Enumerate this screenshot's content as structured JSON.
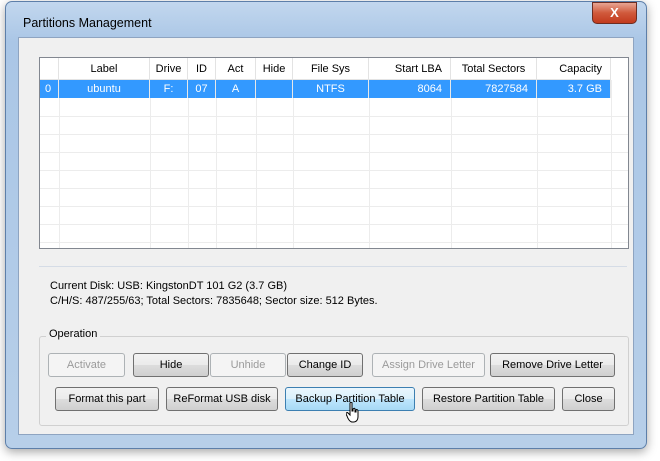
{
  "window": {
    "title": "Partitions Management",
    "close_glyph": "X"
  },
  "table": {
    "columns": [
      "",
      "Label",
      "Drive",
      "ID",
      "Act",
      "Hide",
      "File Sys",
      "Start LBA",
      "Total Sectors",
      "Capacity"
    ],
    "rows": [
      {
        "index": "0",
        "label": "ubuntu",
        "drive": "F:",
        "id": "07",
        "act": "A",
        "hide": "",
        "fs": "NTFS",
        "start_lba": "8064",
        "total_sectors": "7827584",
        "capacity": "3.7 GB"
      }
    ]
  },
  "disk_info": {
    "line1": "Current Disk:   USB: KingstonDT 101 G2 (3.7 GB)",
    "line2": "C/H/S: 487/255/63; Total Sectors: 7835648; Sector size: 512 Bytes."
  },
  "operation": {
    "label": "Operation",
    "buttons": {
      "activate": "Activate",
      "hide": "Hide",
      "unhide": "Unhide",
      "change_id": "Change ID",
      "assign_letter": "Assign Drive Letter",
      "remove_letter": "Remove Drive Letter",
      "format_part": "Format this part",
      "reformat_usb": "ReFormat USB disk",
      "backup_table": "Backup Partition Table",
      "restore_table": "Restore Partition Table",
      "close": "Close"
    }
  },
  "colors": {
    "selection": "#3399ff",
    "close_button": "#c8452a"
  }
}
